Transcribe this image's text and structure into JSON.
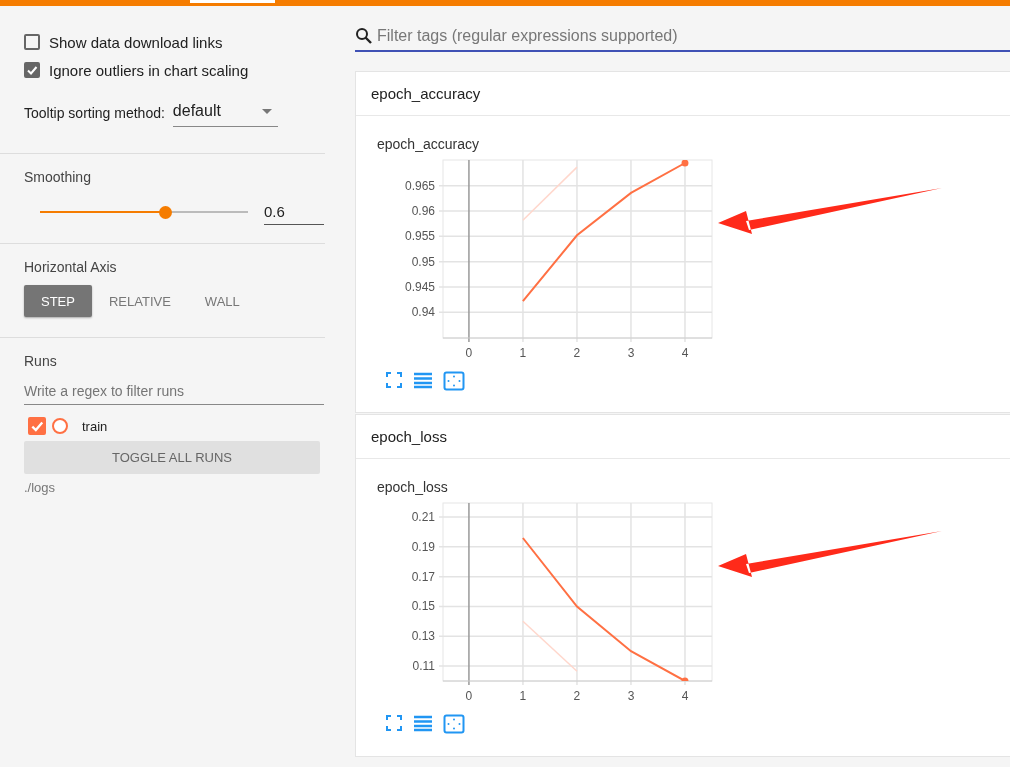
{
  "header": {
    "tab_indicator": true
  },
  "sidebar": {
    "options": [
      {
        "label": "Show data download links",
        "checked": false
      },
      {
        "label": "Ignore outliers in chart scaling",
        "checked": true
      }
    ],
    "tooltip_sorting": {
      "label": "Tooltip sorting method:",
      "value": "default"
    },
    "smoothing": {
      "label": "Smoothing",
      "level": 0.6,
      "value": "0.6"
    },
    "horizontal_axis": {
      "label": "Horizontal Axis",
      "options": [
        {
          "label": "STEP",
          "selected": true
        },
        {
          "label": "RELATIVE",
          "selected": false
        },
        {
          "label": "WALL",
          "selected": false
        }
      ]
    },
    "runs": {
      "label": "Runs",
      "filter_placeholder": "Write a regex to filter runs",
      "items": [
        {
          "name": "train",
          "checked": true,
          "color": "#ff7043"
        }
      ],
      "toggle_button": "TOGGLE ALL RUNS",
      "logdir": "./logs"
    }
  },
  "filter": {
    "placeholder": "Filter tags (regular expressions supported)"
  },
  "cards": [
    {
      "title": "epoch_accuracy",
      "chart_title": "epoch_accuracy",
      "arrow_annotation": true,
      "chart_data": {
        "type": "line",
        "grid": true,
        "x": [
          1,
          2,
          3,
          4
        ],
        "xlim": [
          -0.48,
          4.5
        ],
        "ylim": [
          0.9349,
          0.9701
        ],
        "xticks": [
          0,
          1,
          2,
          3,
          4
        ],
        "yticks": [
          0.94,
          0.945,
          0.95,
          0.955,
          0.96,
          0.965
        ],
        "series": [
          {
            "color": "#ffd7cc",
            "values": [
              0.9582,
              0.9687,
              null,
              null
            ]
          },
          {
            "color": "#ff7043",
            "values": [
              0.9422,
              0.9552,
              0.9636,
              0.9695
            ]
          }
        ]
      }
    },
    {
      "title": "epoch_loss",
      "chart_title": "epoch_loss",
      "arrow_annotation": true,
      "chart_data": {
        "type": "line",
        "grid": true,
        "x": [
          1,
          2,
          3,
          4
        ],
        "xlim": [
          -0.48,
          4.5
        ],
        "ylim": [
          0.1,
          0.2194
        ],
        "xticks": [
          0,
          1,
          2,
          3,
          4
        ],
        "yticks": [
          0.11,
          0.13,
          0.15,
          0.17,
          0.19,
          0.21
        ],
        "series": [
          {
            "color": "#ffd7cc",
            "values": [
              0.1401,
              0.1066,
              null,
              null
            ]
          },
          {
            "color": "#ff7043",
            "values": [
              0.1959,
              0.15,
              0.12,
              0.1
            ]
          }
        ]
      }
    }
  ]
}
